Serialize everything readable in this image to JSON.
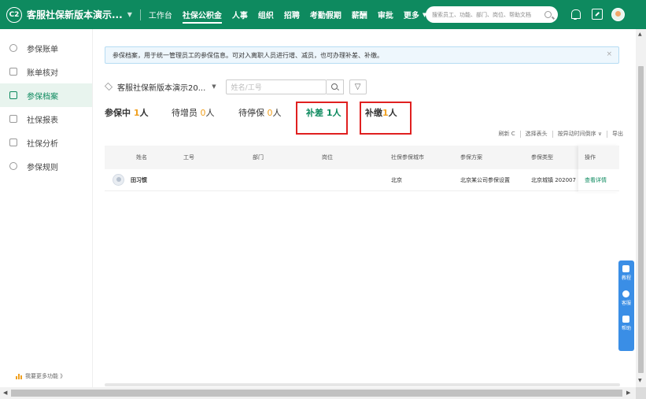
{
  "topbar": {
    "logo": "C2",
    "company": "客服社保新版本演示...",
    "nav": [
      "工作台",
      "社保公积金",
      "人事",
      "组织",
      "招聘",
      "考勤假期",
      "薪酬",
      "审批",
      "更多"
    ],
    "active_nav": "社保公积金",
    "search_placeholder": "搜索员工、功能、部门、岗位、帮助文档",
    "icons": [
      "bell-icon",
      "edit-icon",
      "avatar"
    ]
  },
  "sidebar": {
    "items": [
      {
        "label": "参保账单",
        "icon": "bill-icon"
      },
      {
        "label": "账单核对",
        "icon": "check-icon"
      },
      {
        "label": "参保档案",
        "icon": "archive-icon",
        "active": true
      },
      {
        "label": "社保报表",
        "icon": "report-icon"
      },
      {
        "label": "社保分析",
        "icon": "chart-icon"
      },
      {
        "label": "参保规则",
        "icon": "settings-icon"
      }
    ],
    "more_label": "我要更多功能 》"
  },
  "notice": {
    "text": "参保档案，用于统一管理员工的参保信息。可对入离职人员进行增、减员，也可办理补差、补缴。",
    "close": "×"
  },
  "filters": {
    "company_select": "客服社保新版本演示20...",
    "name_placeholder": "姓名/工号"
  },
  "tabs": [
    {
      "label": "参保中",
      "count": "1",
      "unit": "人"
    },
    {
      "label": "待增员",
      "count": "0",
      "unit": "人"
    },
    {
      "label": "待停保",
      "count": "0",
      "unit": "人"
    },
    {
      "label": "补差",
      "count": "1",
      "unit": "人",
      "selected": true
    },
    {
      "label": "补缴",
      "count": "1",
      "unit": "人"
    }
  ],
  "toolbar": {
    "refresh": "刷新 C",
    "columns": "选择表头",
    "sort": "按异动时间倒序 ∨",
    "export": "导出"
  },
  "table": {
    "headers": [
      "姓名",
      "工号",
      "部门",
      "岗位",
      "社保参保城市",
      "参保方案",
      "参保类型",
      "操作"
    ],
    "rows": [
      {
        "name": "田习惯",
        "id": "",
        "dept": "",
        "post": "",
        "city": "北京",
        "plan": "北京某公司参保设置",
        "type": "北京城镇 202007",
        "action": "查看详情"
      }
    ]
  },
  "floatbar": {
    "items": [
      {
        "label": "教程",
        "icon": "tutorial-icon"
      },
      {
        "label": "客服",
        "icon": "support-icon"
      },
      {
        "label": "帮助",
        "icon": "help-icon"
      }
    ]
  },
  "colors": {
    "brand": "#0e8a5f",
    "count": "#f0a020",
    "highlight_box": "#e02020",
    "float": "#3a8ee6"
  }
}
